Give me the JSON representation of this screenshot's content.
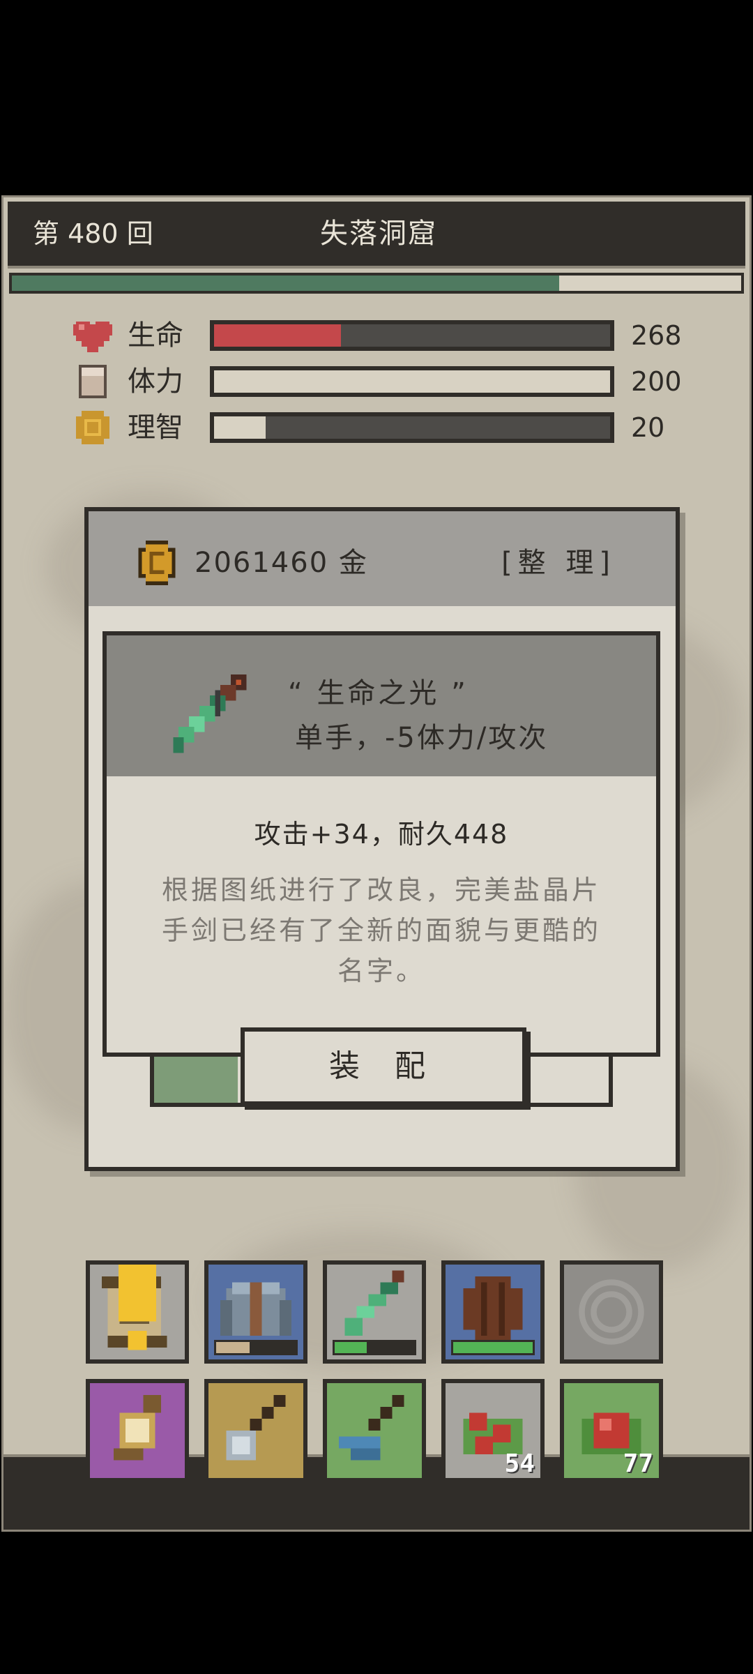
{
  "header": {
    "round": "第 480 回",
    "location": "失落洞窟",
    "progress": 0.75
  },
  "stats": [
    {
      "icon": "heart-icon",
      "label": "生命",
      "value": "268",
      "fill": 0.32,
      "color": "#c4484b"
    },
    {
      "icon": "stamina-icon",
      "label": "体力",
      "value": "200",
      "fill": 1.0,
      "color": "#d8d2c3"
    },
    {
      "icon": "sanity-icon",
      "label": "理智",
      "value": "20",
      "fill": 0.13,
      "color": "#d8d2c3"
    }
  ],
  "shop": {
    "gold": "2061460 金",
    "sort_label": "[整 理]"
  },
  "item": {
    "name": "“ 生命之光 ”",
    "type": "单手，-5体力/攻次",
    "stats": "攻击+34，耐久448",
    "description": "根据图纸进行了改良，完美盐晶片手剑已经有了全新的面貌与更酷的名字。",
    "equip_label": "装 配"
  },
  "inventory": {
    "row1": [
      {
        "name": "scroll-icon",
        "bg": "#a7a5a0",
        "alert": true
      },
      {
        "name": "armor-icon",
        "bg": "#5670a4",
        "durability": 0.42,
        "meter_color": "#c8b290"
      },
      {
        "name": "sword-icon",
        "bg": "#a7a5a0",
        "durability": 0.4,
        "meter_color": "#53b456"
      },
      {
        "name": "shield-icon",
        "bg": "#5670a4",
        "durability": 1.0,
        "meter_color": "#53b456"
      },
      {
        "name": "empty-ring-icon",
        "bg": "#8f8d89"
      }
    ],
    "row2": [
      {
        "name": "lantern-icon",
        "bg": "#9a5aa8"
      },
      {
        "name": "axe-icon",
        "bg": "#b69a52"
      },
      {
        "name": "pickaxe-icon",
        "bg": "#76a862"
      },
      {
        "name": "berries-icon",
        "bg": "#a7a5a0",
        "count": "54"
      },
      {
        "name": "apple-icon",
        "bg": "#76a862",
        "count": "77"
      }
    ]
  },
  "colors": {
    "dark": "#302d29",
    "paper": "#dedad0",
    "accent_green": "#4f7a60"
  }
}
